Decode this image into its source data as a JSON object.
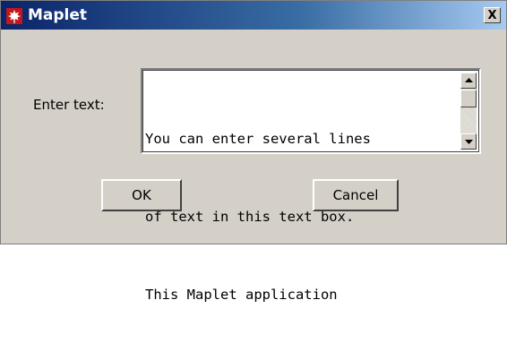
{
  "window": {
    "title": "Maplet",
    "close_label": "X"
  },
  "form": {
    "label": "Enter text:",
    "textbox_lines": [
      "You can enter several lines",
      "of text in this text box.",
      "This Maplet application"
    ]
  },
  "buttons": {
    "ok_label": "OK",
    "cancel_label": "Cancel"
  },
  "icons": {
    "app": "maple-leaf-icon",
    "close": "close-icon",
    "scroll_up": "scroll-up-arrow-icon",
    "scroll_down": "scroll-down-arrow-icon"
  },
  "colors": {
    "title_start": "#0a246a",
    "title_end": "#a6caf0",
    "dialog_bg": "#d4d0c8"
  }
}
